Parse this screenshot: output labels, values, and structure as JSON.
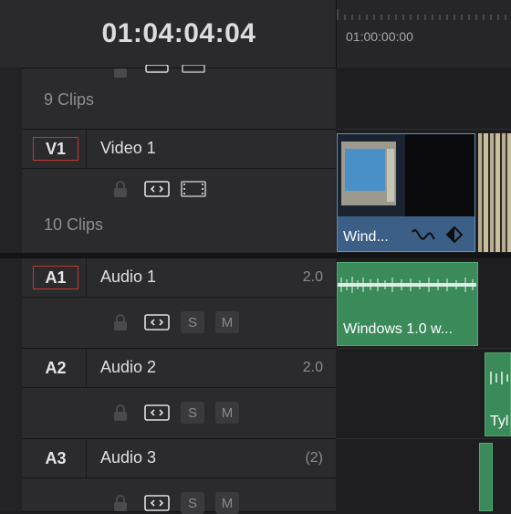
{
  "timecode": "01:04:04:04",
  "ruler": {
    "start_label": "01:00:00:00"
  },
  "upper_track": {
    "clip_count": "9 Clips"
  },
  "tracks": [
    {
      "badge": "V1",
      "name": "Video 1",
      "value": "",
      "clip_count": "10 Clips"
    },
    {
      "badge": "A1",
      "name": "Audio 1",
      "value": "2.0"
    },
    {
      "badge": "A2",
      "name": "Audio 2",
      "value": "2.0"
    },
    {
      "badge": "A3",
      "name": "Audio 3",
      "value": "(2)"
    }
  ],
  "buttons": {
    "solo": "S",
    "mute": "M"
  },
  "clips": {
    "video": "Wind...",
    "audio1": "Windows 1.0 w...",
    "audio2": "Tyl"
  },
  "icons": [
    "lock-icon",
    "auto-track-icon",
    "film-icon",
    "curve-icon",
    "keyframe-icon"
  ],
  "colors": {
    "selected_border": "#c0392b",
    "video_clip": "#3b5f86",
    "audio_clip": "#3a8a5a"
  }
}
